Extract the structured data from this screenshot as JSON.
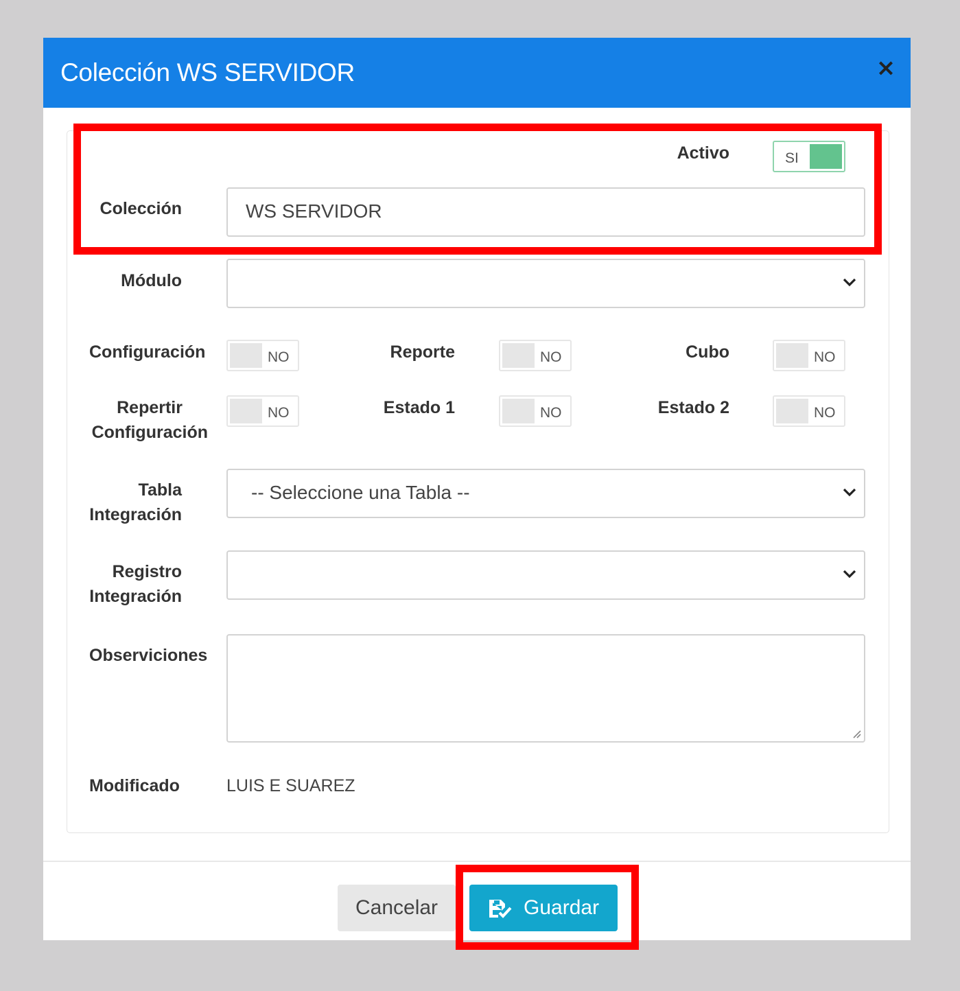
{
  "modal": {
    "title": "Colección WS SERVIDOR",
    "close_label": "×"
  },
  "form": {
    "activo": {
      "label": "Activo",
      "value": "SI"
    },
    "coleccion": {
      "label": "Colección",
      "value": "WS SERVIDOR"
    },
    "modulo": {
      "label": "Módulo",
      "value": ""
    },
    "toggles": [
      {
        "label": "Configuración",
        "value": "NO"
      },
      {
        "label": "Reporte",
        "value": "NO"
      },
      {
        "label": "Cubo",
        "value": "NO"
      },
      {
        "label_line1": "Repertir",
        "label_line2": "Configuración",
        "value": "NO"
      },
      {
        "label": "Estado 1",
        "value": "NO"
      },
      {
        "label": "Estado 2",
        "value": "NO"
      }
    ],
    "tabla_integracion": {
      "label_line1": "Tabla",
      "label_line2": "Integración",
      "value": "-- Seleccione una Tabla --"
    },
    "registro_integracion": {
      "label_line1": "Registro",
      "label_line2": "Integración",
      "value": ""
    },
    "observaciones": {
      "label": "Observiciones",
      "value": ""
    },
    "modificado": {
      "label": "Modificado",
      "value": "LUIS E SUAREZ"
    }
  },
  "footer": {
    "cancel_label": "Cancelar",
    "save_label": "Guardar"
  },
  "colors": {
    "header": "#1580e6",
    "save_button": "#13a6cd",
    "toggle_on": "#63c38e",
    "highlight": "#ff0000"
  },
  "icons": {
    "close": "close-icon",
    "chevron": "chevron-down-icon",
    "save": "save-check-icon"
  }
}
